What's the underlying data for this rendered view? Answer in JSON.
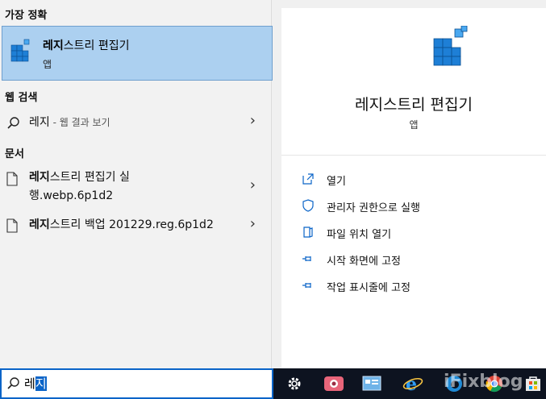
{
  "best_match": {
    "header": "가장 정확",
    "title_bold": "레지",
    "title_rest": "스트리 편집기",
    "subtitle": "앱"
  },
  "web_search": {
    "header": "웹 검색",
    "query_bold": "레지",
    "query_suffix": " - 웹 결과 보기"
  },
  "documents": {
    "header": "문서",
    "items": [
      {
        "bold": "레지",
        "line1": "스트리 편집기 실",
        "line2": "행.webp.6p1d2"
      },
      {
        "bold": "레지",
        "line1": "스트리 백업 201229.reg.6p1d2",
        "line2": ""
      }
    ]
  },
  "preview": {
    "app_name": "레지스트리 편집기",
    "app_kind": "앱",
    "actions": [
      {
        "label": "열기",
        "icon": "open-icon"
      },
      {
        "label": "관리자 권한으로 실행",
        "icon": "shield-icon"
      },
      {
        "label": "파일 위치 열기",
        "icon": "file-location-icon"
      },
      {
        "label": "시작 화면에 고정",
        "icon": "pin-icon"
      },
      {
        "label": "작업 표시줄에 고정",
        "icon": "pin-icon"
      }
    ]
  },
  "search": {
    "query_plain": "레",
    "query_selected": "지"
  },
  "taskbar": {
    "icons": [
      "settings-icon",
      "media-icon",
      "control-panel-icon",
      "internet-explorer-icon",
      "edge-icon",
      "chrome-icon",
      "store-icon"
    ],
    "watermark": "iFixblog"
  },
  "colors": {
    "accent": "#0a64c8",
    "selection_bg": "#acd0f0",
    "taskbar_bg": "#0d1320"
  }
}
